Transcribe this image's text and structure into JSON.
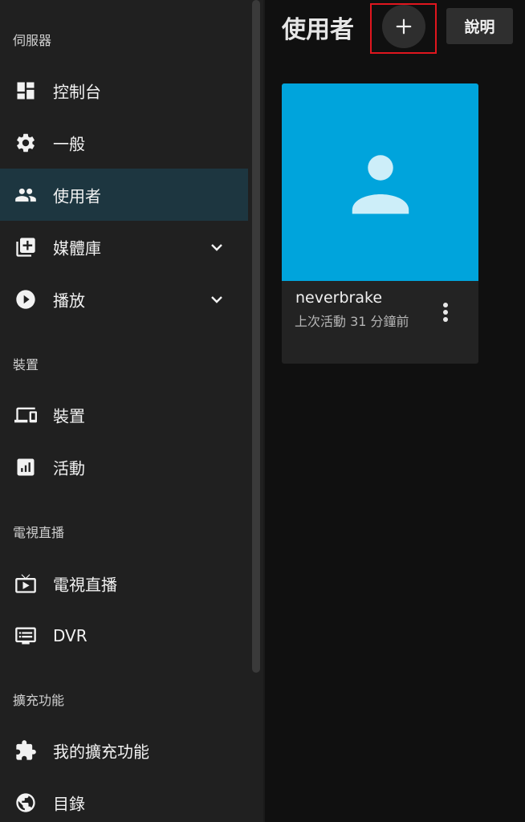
{
  "sidebar": {
    "sections": [
      {
        "label": "伺服器"
      },
      {
        "label": "裝置"
      },
      {
        "label": "電視直播"
      },
      {
        "label": "擴充功能"
      }
    ],
    "items": [
      {
        "label": "控制台",
        "icon": "dashboard-icon"
      },
      {
        "label": "一般",
        "icon": "gear-icon"
      },
      {
        "label": "使用者",
        "icon": "people-icon",
        "active": true
      },
      {
        "label": "媒體庫",
        "icon": "library-add-icon",
        "expandable": true
      },
      {
        "label": "播放",
        "icon": "play-circle-icon",
        "expandable": true
      },
      {
        "label": "裝置",
        "icon": "devices-icon"
      },
      {
        "label": "活動",
        "icon": "activity-chart-icon"
      },
      {
        "label": "電視直播",
        "icon": "live-tv-icon"
      },
      {
        "label": "DVR",
        "icon": "dvr-icon"
      },
      {
        "label": "我的擴充功能",
        "icon": "puzzle-icon"
      },
      {
        "label": "目錄",
        "icon": "globe-icon"
      }
    ]
  },
  "header": {
    "title": "使用者",
    "add_button_icon": "plus-icon",
    "help_label": "說明"
  },
  "user_card": {
    "name": "neverbrake",
    "last_active": "上次活動 31 分鐘前",
    "avatar_icon": "person-icon",
    "menu_icon": "more-vertical-icon"
  },
  "colors": {
    "accent": "#00a4dc",
    "active_item_bg": "#1d3640",
    "highlight_border": "#e0161e",
    "sidebar_bg": "#202020",
    "page_bg": "#101010"
  }
}
